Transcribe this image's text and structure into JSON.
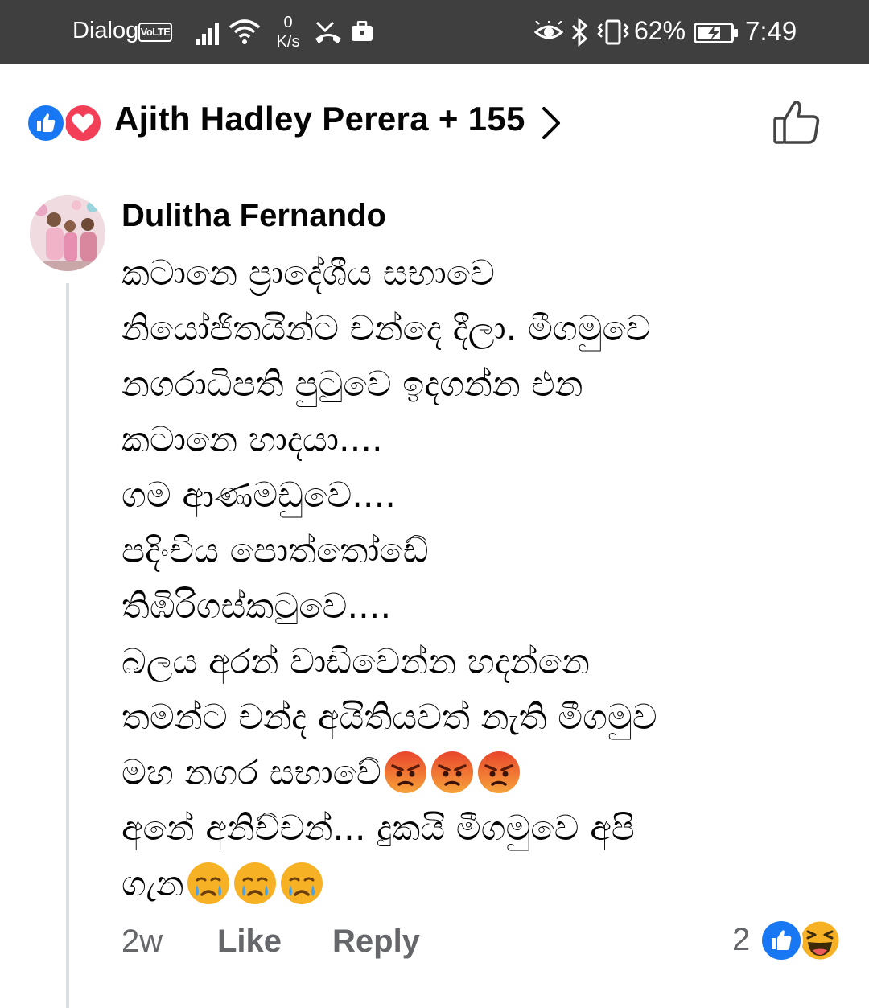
{
  "status_bar": {
    "carrier": "Dialog",
    "volte": "VoLTE",
    "net_speed_value": "0",
    "net_speed_unit": "K/s",
    "battery_percent": "62%",
    "time": "7:49",
    "icons": [
      "signal-icon",
      "wifi-icon",
      "missed-call-icon",
      "briefcase-icon",
      "eye-icon",
      "bluetooth-icon",
      "vibrate-icon",
      "battery-charging-icon"
    ]
  },
  "reactions_header": {
    "names": "Ajith Hadley Perera + 155",
    "icons": [
      "like-reaction-icon",
      "love-reaction-icon",
      "chevron-right-icon",
      "thumbs-up-outline-icon"
    ]
  },
  "comment": {
    "author": "Dulitha Fernando",
    "lines": [
      "කටානෙ ප්‍රාදේශීය සභාවෙ",
      "නියෝජිතයින්ට චන්දෙ දීලා. මීගමුවෙ",
      "නගරාධිපති පුටුවෙ ඉදගන්න එන",
      "කටානෙ හාදයා....",
      "ගම ආණමඩුවෙ....",
      "පදිංචිය පොත්තෝඩේ",
      "තිඹිරිගස්කටුවෙ....",
      "බලය අරන් වාඩිවෙන්න හදන්නෙ",
      "තමන්ට චන්ද අයිතියවත් නැති මීගමුව",
      "මහ නගර සභාවේ",
      "අනේ අනිච්චන්... දුකයි මීගමුවෙ අපි",
      "ගැන"
    ],
    "emoji": {
      "line_10": [
        "angry-face-icon",
        "angry-face-icon",
        "angry-face-icon"
      ],
      "line_12": [
        "crying-face-icon",
        "crying-face-icon",
        "crying-face-icon"
      ]
    },
    "time_ago": "2w",
    "like_label": "Like",
    "reply_label": "Reply",
    "reaction_count": "2",
    "reaction_icons": [
      "like-reaction-icon",
      "haha-reaction-icon"
    ]
  },
  "colors": {
    "status_bar_bg": "#3f3f3f",
    "like_blue": "#1877f2",
    "love_red": "#f33e58",
    "meta_gray": "#65676b",
    "angry_red": "#e8452c",
    "emoji_yellow": "#f7b125"
  }
}
